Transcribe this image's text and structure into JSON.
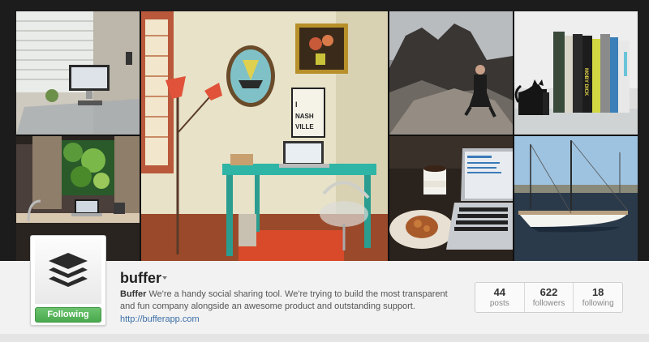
{
  "profile": {
    "username": "buffer",
    "bio_name": "Buffer",
    "bio_text": " We're a handy social sharing tool. We're trying to build the most transparent and fun company alongside an awesome product and outstanding support.",
    "website": "http://bufferapp.com",
    "follow_label": "Following",
    "avatar_icon": "buffer-logo-icon"
  },
  "stats": [
    {
      "count": "44",
      "label": "posts"
    },
    {
      "count": "622",
      "label": "followers"
    },
    {
      "count": "18",
      "label": "following"
    }
  ],
  "cover_photos": [
    {
      "name": "photo-desk-window"
    },
    {
      "name": "photo-office-desk-teal"
    },
    {
      "name": "photo-man-on-rocks"
    },
    {
      "name": "photo-books-cat-bookend"
    },
    {
      "name": "photo-desk-green-window"
    },
    {
      "name": "photo-coffee-laptop"
    },
    {
      "name": "photo-sailboat-harbor"
    }
  ],
  "colors": {
    "follow_green": "#4aa94e",
    "link_blue": "#3b6fa8",
    "desk_teal": "#2fb5a6"
  }
}
